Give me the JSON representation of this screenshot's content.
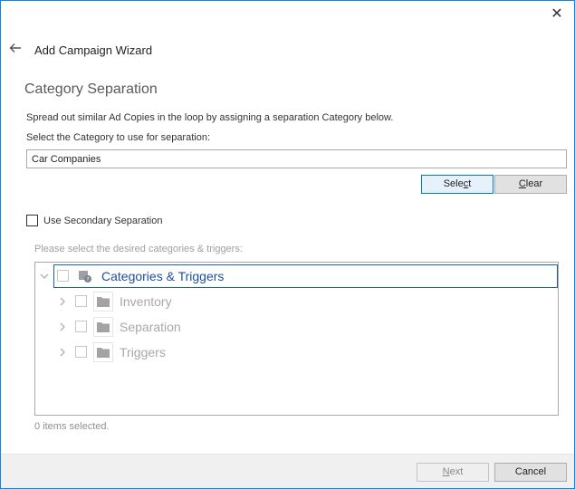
{
  "window": {
    "close_glyph": "✕"
  },
  "header": {
    "title": "Add Campaign Wizard",
    "back_icon": "arrow-left-icon"
  },
  "section": {
    "title": "Category Separation",
    "description": "Spread out similar Ad Copies in the loop by assigning a separation Category below.",
    "select_label": "Select the Category to use for separation:",
    "category_value": "Car Companies"
  },
  "buttons": {
    "select_prefix": "Sele",
    "select_underlined": "c",
    "select_suffix": "t",
    "clear_underlined": "C",
    "clear_suffix": "lear",
    "next_underlined": "N",
    "next_suffix": "ext",
    "cancel_label": "Cancel"
  },
  "secondary": {
    "label": "Use Secondary Separation",
    "checked": false
  },
  "tree": {
    "hint": "Please select the desired categories & triggers:",
    "root": {
      "label": "Categories & Triggers",
      "icon": "category-trigger-icon",
      "expanded": true
    },
    "children": [
      {
        "label": "Inventory",
        "icon": "folder-icon"
      },
      {
        "label": "Separation",
        "icon": "folder-icon"
      },
      {
        "label": "Triggers",
        "icon": "folder-icon"
      }
    ]
  },
  "status": {
    "items_selected": "0 items selected."
  },
  "colors": {
    "accent": "#0078d7",
    "window_border": "#1883d7",
    "root_highlight": "#1c5fb0"
  }
}
